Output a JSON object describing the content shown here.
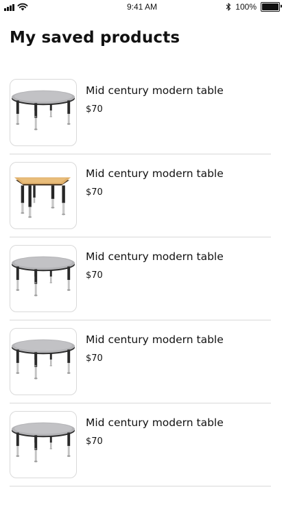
{
  "status_bar": {
    "time": "9:41 AM",
    "battery_text": "100%",
    "battery_level": 1.0,
    "icons": [
      "signal-icon",
      "wifi-icon",
      "bluetooth-icon",
      "battery-icon"
    ]
  },
  "page": {
    "title": "My saved products"
  },
  "products": [
    {
      "name": "Mid century modern table",
      "price": "$70",
      "image": "round-table-grey"
    },
    {
      "name": "Mid century modern table",
      "price": "$70",
      "image": "trapezoid-table-wood"
    },
    {
      "name": "Mid century modern table",
      "price": "$70",
      "image": "round-table-grey"
    },
    {
      "name": "Mid century modern table",
      "price": "$70",
      "image": "round-table-grey"
    },
    {
      "name": "Mid century modern table",
      "price": "$70",
      "image": "round-table-grey"
    }
  ]
}
